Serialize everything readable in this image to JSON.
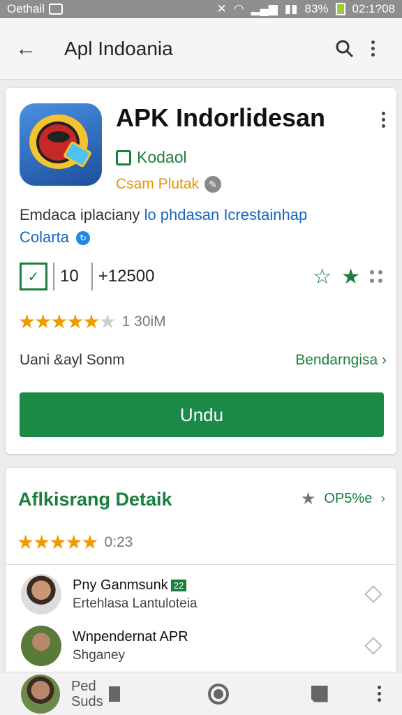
{
  "status_bar": {
    "carrier": "Oethail",
    "battery_percent": "83%",
    "time": "02:1?08"
  },
  "app_bar": {
    "title": "Apl Indoania",
    "back_icon": "arrow-back-icon",
    "search_icon": "search-icon",
    "menu_icon": "more-vert-icon"
  },
  "app": {
    "name": "APK Indorlidesan",
    "developer": "Kodaol",
    "category": "Csam Plutak",
    "description_part1": "Emdaca iplaciany",
    "description_part2": "lo phdasan Icrestainhap",
    "description_part3": "Colarta",
    "stat_value": "10",
    "stat_count": "+12500",
    "rating": 4.5,
    "rating_stars": "★★★★★",
    "rating_count": "1 30iM",
    "size_label": "Uani &ayl Sonm",
    "size_link": "Bendarngisa ›",
    "install_label": "Undu"
  },
  "reviews": {
    "title": "Aflkisrang Detaik",
    "sort_label": "OP5%e",
    "sort_chevron": "›",
    "rating_stars": "★★★★★",
    "rating_value": "0:23",
    "items": [
      {
        "name": "Pny Ganmsunk",
        "badge": "22",
        "body": "Ertehlasa  Lantuloteia"
      },
      {
        "name": "Wnpendernat APR",
        "body": "Shganey"
      }
    ]
  },
  "nav": {
    "peek_line1": "Ped",
    "peek_line2": "Suds"
  },
  "colors": {
    "accent_green": "#1a8a46",
    "star_orange": "#f29900",
    "link_blue": "#1565c0"
  }
}
